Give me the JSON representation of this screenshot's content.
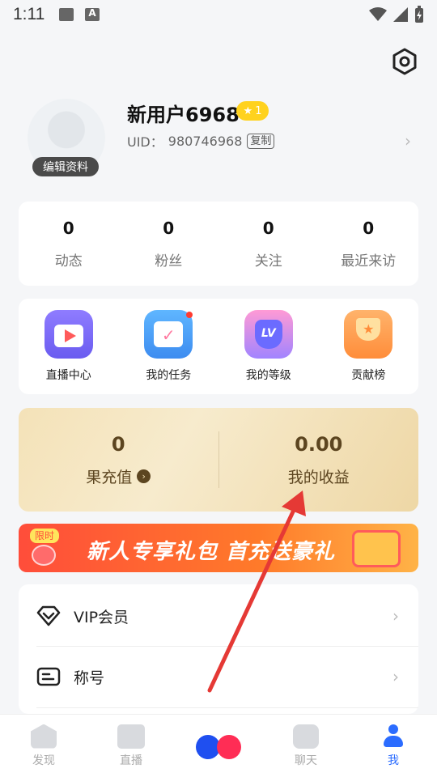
{
  "status_bar": {
    "time": "1:11",
    "icons": [
      "image-icon",
      "a-notification-icon",
      "wifi-icon",
      "signal-icon",
      "battery-charging-icon"
    ]
  },
  "profile": {
    "username": "新用户6968",
    "level_badge": "1",
    "uid_label": "UID：",
    "uid_value": "980746968",
    "copy_label": "复制",
    "edit_label": "编辑资料"
  },
  "stats": [
    {
      "value": "0",
      "label": "动态"
    },
    {
      "value": "0",
      "label": "粉丝"
    },
    {
      "value": "0",
      "label": "关注"
    },
    {
      "value": "0",
      "label": "最近来访"
    }
  ],
  "features": [
    {
      "label": "直播中心",
      "icon": "tv-play-icon"
    },
    {
      "label": "我的任务",
      "icon": "calendar-check-icon"
    },
    {
      "label": "我的等级",
      "icon": "lv-shield-icon"
    },
    {
      "label": "贡献榜",
      "icon": "trophy-icon"
    }
  ],
  "wallet": {
    "recharge_value": "0",
    "recharge_label": "果充值",
    "earnings_value": "0.00",
    "earnings_label": "我的收益"
  },
  "banner": {
    "tag": "限时",
    "text": "新人专享礼包 首充送豪礼"
  },
  "menu": [
    {
      "label": "VIP会员",
      "icon": "diamond-icon"
    },
    {
      "label": "称号",
      "icon": "id-card-icon"
    }
  ],
  "tabbar": [
    {
      "label": "发现",
      "icon": "home-icon"
    },
    {
      "label": "直播",
      "icon": "video-camera-icon"
    },
    {
      "label": "",
      "icon": "center-dots-icon"
    },
    {
      "label": "聊天",
      "icon": "chat-bubble-icon"
    },
    {
      "label": "我",
      "icon": "person-icon",
      "active": true
    }
  ],
  "colors": {
    "accent": "#2b6cff",
    "background": "#f5f6f8",
    "wallet_text": "#5c4520",
    "annotation_arrow": "#e53935"
  }
}
